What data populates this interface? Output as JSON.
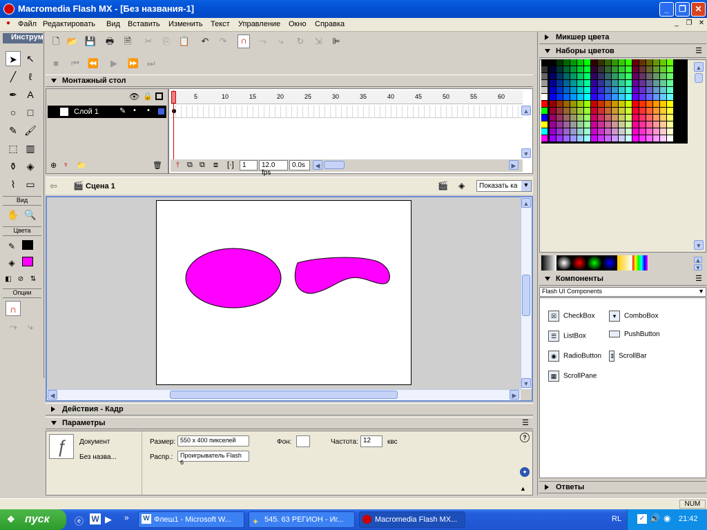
{
  "window": {
    "title": "Macromedia Flash MX - [Без названия-1]"
  },
  "menu": [
    "Файл",
    "Редактировать",
    "Вид",
    "Вставить",
    "Изменить",
    "Текст",
    "Управление",
    "Окно",
    "Справка"
  ],
  "tools": {
    "header": "Инструменты",
    "view_label": "Вид",
    "colors_label": "Цвета",
    "options_label": "Опции",
    "stroke_color": "#000000",
    "fill_color": "#ff00ff"
  },
  "timeline": {
    "title": "Монтажный стол",
    "layer_name": "Слой 1",
    "ruler": [
      "1",
      "5",
      "10",
      "15",
      "20",
      "25",
      "30",
      "35",
      "40",
      "45",
      "50",
      "55",
      "60"
    ],
    "current_frame": "1",
    "fps": "12.0 fps",
    "time": "0.0s"
  },
  "scene": {
    "name": "Сцена 1",
    "zoom": "Показать ка"
  },
  "stage": {
    "shape_color": "#ff00ff"
  },
  "panels": {
    "actions": "Действия - Кадр",
    "params": "Параметры",
    "color_mixer": "Микшер цвета",
    "color_sets": "Наборы цветов",
    "components": "Компоненты",
    "answers": "Ответы"
  },
  "properties": {
    "doc_label": "Документ",
    "doc_name": "Без назва...",
    "size_label": "Размер:",
    "size_value": "550 x 400 пикселей",
    "publish_label": "Распр.:",
    "publish_value": "Проигрыватель Flash 6",
    "bg_label": "Фон:",
    "rate_label": "Частота:",
    "rate_value": "12",
    "rate_unit": "квс"
  },
  "components": {
    "set": "Flash UI Components",
    "items": [
      "CheckBox",
      "ComboBox",
      "ListBox",
      "PushButton",
      "RadioButton",
      "ScrollBar",
      "ScrollPane"
    ]
  },
  "status": {
    "num": "NUM"
  },
  "taskbar": {
    "start": "пуск",
    "tasks": [
      "Флеш1 - Microsoft W...",
      "545. 63 РЕГИОН - Иг...",
      "Macromedia Flash MX..."
    ],
    "lang": "RL",
    "clock": "21:42"
  }
}
